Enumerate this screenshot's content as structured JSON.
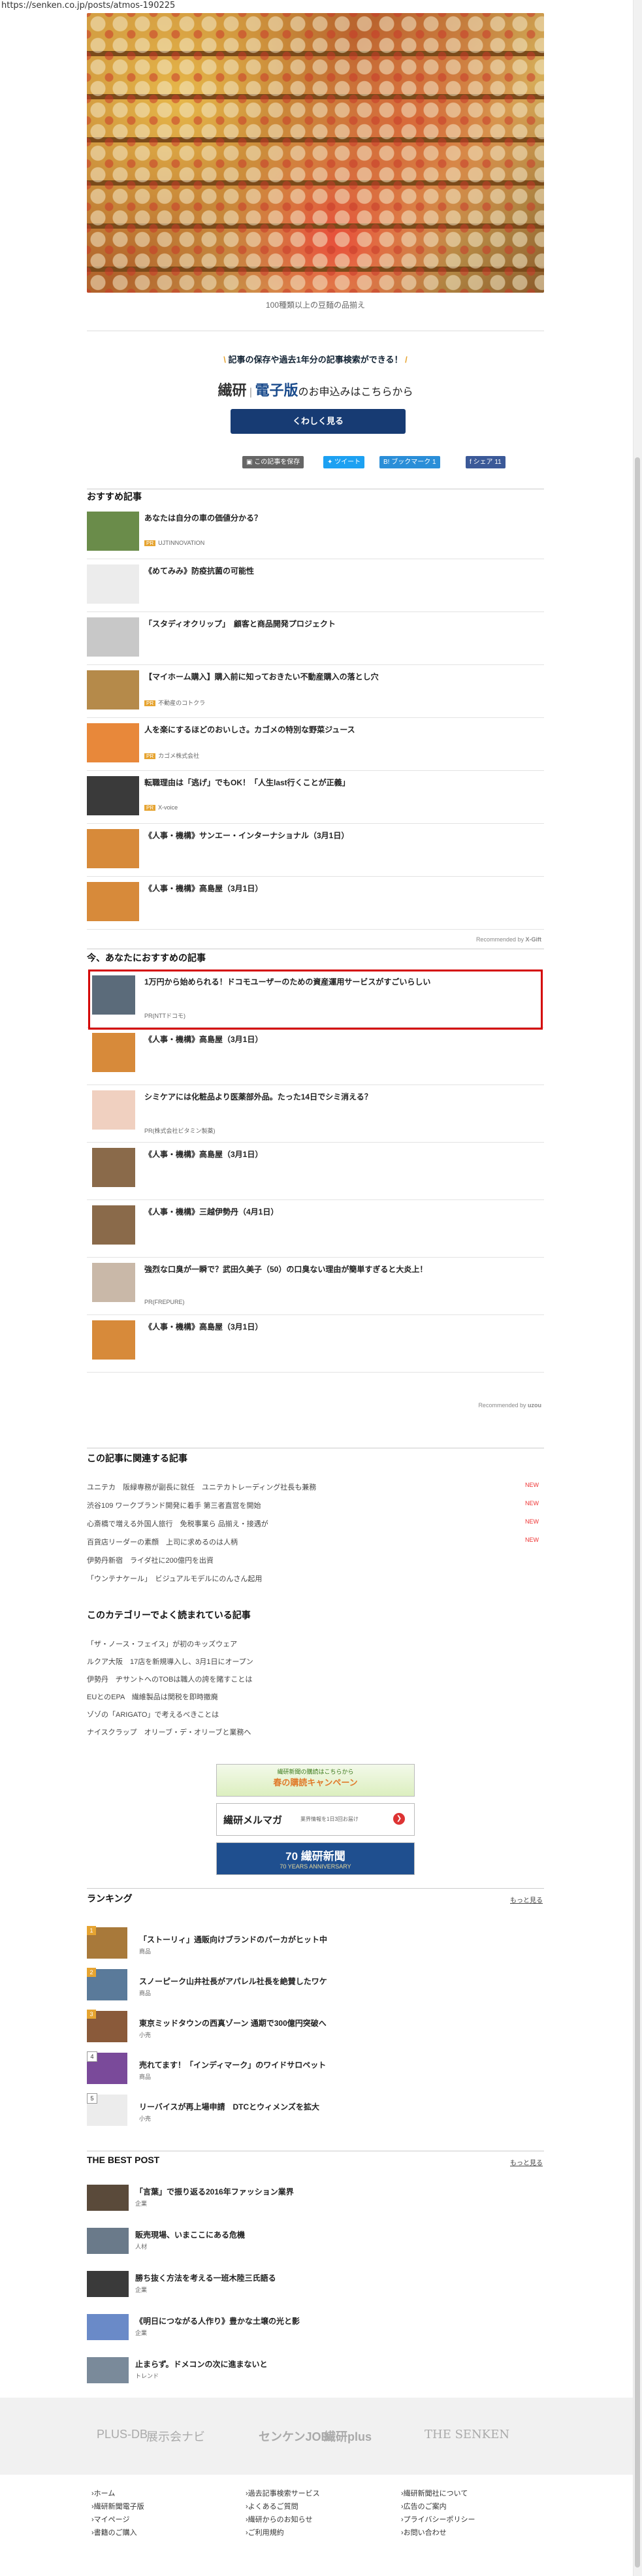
{
  "url": "https://senken.co.jp/posts/atmos-190225",
  "hero": {
    "caption": "100種類以上の豆麺の品揃え"
  },
  "promo": {
    "lead": "記事の保存や過去1年分の記事検索ができる！",
    "brand": "繊研",
    "edition": "電子版",
    "suffix": "のお申込みはこちらから",
    "button": "くわしく見る"
  },
  "share": {
    "save": "この記事を保存",
    "tweet": "ツイート",
    "bookmark": "B! ブックマーク",
    "bookmark_count": "1",
    "facebook": "シェア",
    "facebook_count": "11"
  },
  "recommended": {
    "title": "おすすめ記事",
    "items": [
      {
        "title": "あなたは自分の車の価値分かる？",
        "sponsor": "UJTINNOVATION",
        "pr": true
      },
      {
        "title": "《めてみみ》防疫抗菌の可能性",
        "sponsor": "",
        "pr": false
      },
      {
        "title": "「スタディオクリップ」　顧客と商品開発プロジェクト",
        "sponsor": "",
        "pr": false
      },
      {
        "title": "【マイホーム購入】購入前に知っておきたい不動産購入の落とし穴",
        "sponsor": "不動産のコトクラ",
        "pr": true
      },
      {
        "title": "人を楽にするほどのおいしさ。カゴメの特別な野菜ジュース",
        "sponsor": "カゴメ株式会社",
        "pr": true
      },
      {
        "title": "転職理由は「逃げ」でもOK！「人生last行くことが正義」",
        "sponsor": "X-voice",
        "pr": true
      },
      {
        "title": "《人事・機構》サンエー・インターナショナル（3月1日）",
        "sponsor": "",
        "pr": false
      },
      {
        "title": "《人事・機構》高島屋（3月1日）",
        "sponsor": "",
        "pr": false
      }
    ],
    "credit": "Recommended by",
    "credit_brand": "X-Gift"
  },
  "for_you": {
    "title": "今、あなたにおすすめの記事",
    "items": [
      {
        "title": "1万円から始められる！ドコモユーザーのための資産運用サービスがすごいらしい",
        "sponsor": "PR(NTTドコモ)"
      },
      {
        "title": "《人事・機構》高島屋（3月1日）",
        "sponsor": ""
      },
      {
        "title": "シミケアには化粧品より医薬部外品。たった14日でシミ消える？",
        "sponsor": "PR(株式会社ビタミン製薬)"
      },
      {
        "title": "《人事・機構》高島屋（3月1日）",
        "sponsor": ""
      },
      {
        "title": "《人事・機構》三越伊勢丹（4月1日）",
        "sponsor": ""
      },
      {
        "title": "強烈な口臭が一瞬で？武田久美子（50）の口臭ない理由が簡単すぎると大炎上！",
        "sponsor": "PR(FREPURE)"
      },
      {
        "title": "《人事・機構》高島屋（3月1日）",
        "sponsor": ""
      }
    ],
    "credit": "Recommended by",
    "credit_brand": "uzou"
  },
  "related": {
    "title": "この記事に関連する記事",
    "items": [
      {
        "text": "ユニテカ　阪緑専務が副長に就任　ユニテカトレーディング社長も兼務",
        "new": "NEW"
      },
      {
        "text": "渋谷109 ワークブランド開発に着手 第三者直営を開始",
        "new": "NEW"
      },
      {
        "text": "心斎橋で増える外国人旅行　免税事業ら 品揃え・接遇が",
        "new": "NEW"
      },
      {
        "text": "百貨店リーダーの素顔　上司に求めるのは人柄",
        "new": "NEW"
      },
      {
        "text": "伊勢丹新宿　ライダ社に200億円を出資",
        "new": ""
      },
      {
        "text": "「ウンテナケール」　ビジュアルモデルにのんさん起用",
        "new": ""
      }
    ]
  },
  "popular": {
    "title": "このカテゴリーでよく読まれている記事",
    "items": [
      "「ザ・ノース・フェイス」が初のキッズウェア",
      "ルクア大阪　17店を新規導入し、3月1日にオープン",
      "伊勢丹　ヂサントへのTOBは職人の誇を賭すことは",
      "EUとのEPA　繊維製品は関税を即時撤廃",
      "ゾゾの「ARIGATO」で考えるべきことは",
      "ナイスクラップ　オリーブ・デ・オリーブと業務へ"
    ]
  },
  "banners": [
    {
      "label": "繊研新聞の購読はこちらから",
      "sub": "春の購読キャンペーン"
    },
    {
      "label": "繊研メルマガ",
      "sub": "業界情報を1日3回お届け"
    },
    {
      "label": "70 繊研新聞",
      "sub": "70 YEARS ANNIVERSARY"
    }
  ],
  "ranking": {
    "title": "ランキング",
    "more": "もっと見る",
    "items": [
      {
        "num": "1",
        "title": "「ストーリィ」通販向けブランドのパーカがヒット中",
        "cat": "商品"
      },
      {
        "num": "2",
        "title": "スノーピーク山井社長がアパレル社長を絶賛したワケ",
        "cat": "商品"
      },
      {
        "num": "3",
        "title": "東京ミッドタウンの西真ゾーン 通期で300億円突破へ",
        "cat": "小売"
      },
      {
        "num": "4",
        "title": "売れてます！「インディマーク」のワイドサロペット",
        "cat": "商品"
      },
      {
        "num": "5",
        "title": "リーバイスが再上場申請　DTCとウィメンズを拡大",
        "cat": "小売"
      }
    ]
  },
  "best": {
    "title": "THE BEST POST",
    "more": "もっと見る",
    "items": [
      {
        "title": "「言葉」で振り返る2016年ファッション業界",
        "cat": "企業"
      },
      {
        "title": "販売現場、いまここにある危機",
        "cat": "人材"
      },
      {
        "title": "勝ち抜く方法を考える一班木陸三氏語る",
        "cat": "企業"
      },
      {
        "title": "《明日につながる人作り》豊かな土壌の光と影",
        "cat": "企業"
      },
      {
        "title": "止まらず。ドメコンの次に進まないと",
        "cat": "トレンド"
      }
    ]
  },
  "footer": {
    "logos": [
      "PLUS-DB",
      "展示会ナビ",
      "センケンJOB",
      "繊研plus",
      "THE SENKEN"
    ],
    "links": [
      [
        "ホーム",
        "繊研新聞電子版",
        "マイページ",
        "書籍のご購入"
      ],
      [
        "過去記事検索サービス",
        "よくあるご質問",
        "繊研からのお知らせ",
        "ご利用規約"
      ],
      [
        "繊研新聞社について",
        "広告のご案内",
        "プライバシーポリシー",
        "お問い合わせ"
      ]
    ]
  }
}
